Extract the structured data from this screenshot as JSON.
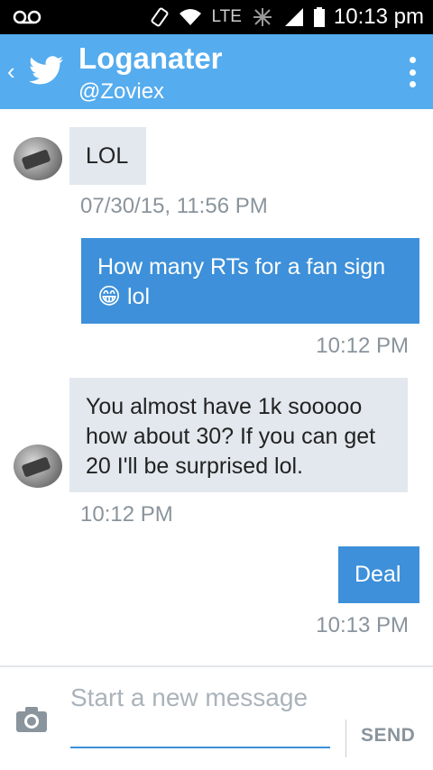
{
  "status_bar": {
    "voicemail_icon": "voicemail-icon",
    "network": "LTE",
    "time": "10:13 pm"
  },
  "header": {
    "title": "Loganater",
    "handle": "@Zoviex",
    "brand_color": "#55acee"
  },
  "messages": [
    {
      "direction": "incoming",
      "text": "LOL",
      "time": "07/30/15, 11:56 PM"
    },
    {
      "direction": "outgoing",
      "text": "How many RTs for a fan sign 😁 lol",
      "time": "10:12 PM"
    },
    {
      "direction": "incoming",
      "text": "You almost have 1k sooooo how about 30? If you can get 20 I'll be surprised lol.",
      "time": "10:12 PM"
    },
    {
      "direction": "outgoing",
      "text": "Deal",
      "time": "10:13 PM"
    }
  ],
  "composer": {
    "placeholder": "Start a new message",
    "send_label": "SEND"
  }
}
